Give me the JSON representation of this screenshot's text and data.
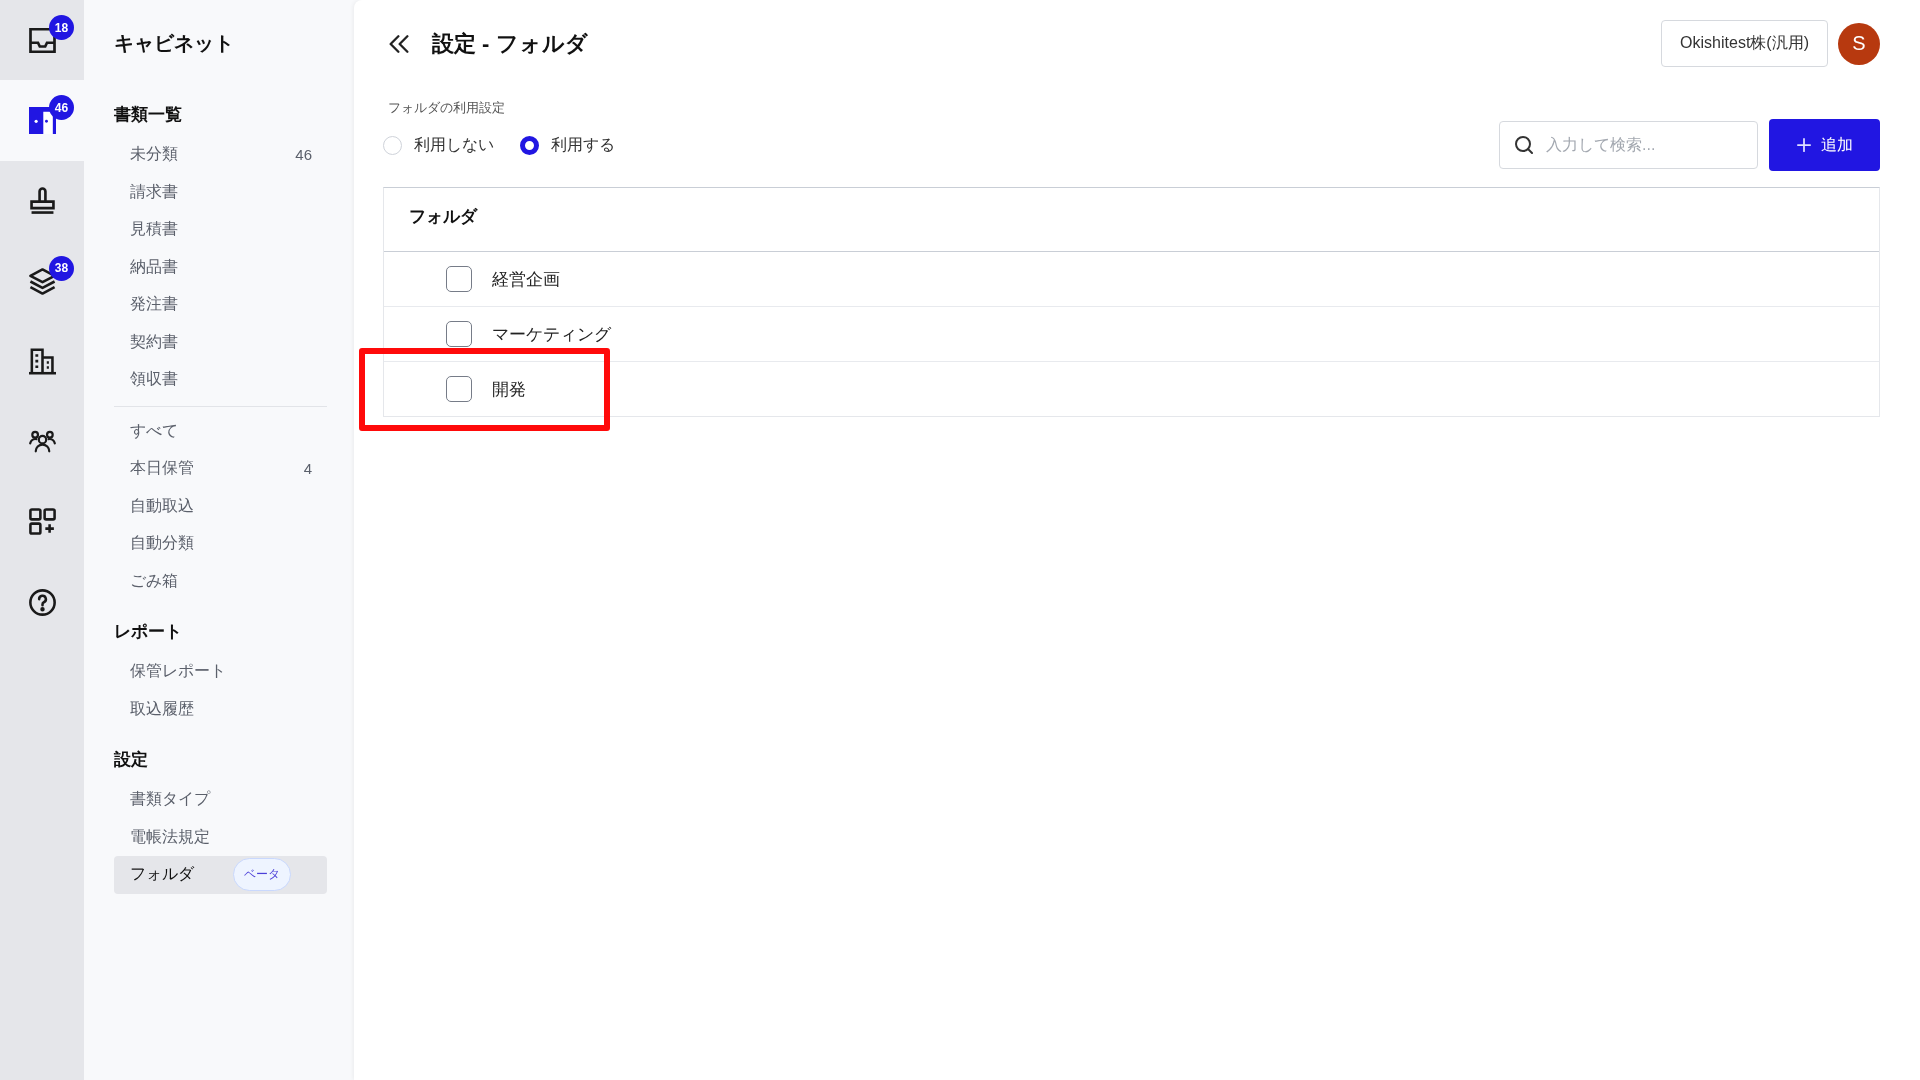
{
  "rail": [
    {
      "kind": "inbox",
      "badge": "18",
      "selected": false
    },
    {
      "kind": "cabinet",
      "badge": "46",
      "selected": true
    },
    {
      "kind": "stamp",
      "selected": false
    },
    {
      "kind": "layers",
      "badge": "38",
      "selected": false
    },
    {
      "kind": "building",
      "selected": false
    },
    {
      "kind": "people",
      "selected": false
    },
    {
      "kind": "apps",
      "selected": false
    },
    {
      "kind": "help",
      "selected": false
    }
  ],
  "sidebar": {
    "title": "キャビネット",
    "sections": [
      {
        "heading": "書類一覧",
        "groups": [
          [
            {
              "label": "未分類",
              "count": "46",
              "selected": false
            },
            {
              "label": "請求書",
              "selected": false
            },
            {
              "label": "見積書",
              "selected": false
            },
            {
              "label": "納品書",
              "selected": false
            },
            {
              "label": "発注書",
              "selected": false
            },
            {
              "label": "契約書",
              "selected": false
            },
            {
              "label": "領収書",
              "selected": false
            }
          ],
          [
            {
              "label": "すべて",
              "selected": false
            },
            {
              "label": "本日保管",
              "count": "4",
              "selected": false
            },
            {
              "label": "自動取込",
              "selected": false
            },
            {
              "label": "自動分類",
              "selected": false
            },
            {
              "label": "ごみ箱",
              "selected": false
            }
          ]
        ]
      },
      {
        "heading": "レポート",
        "groups": [
          [
            {
              "label": "保管レポート",
              "selected": false
            },
            {
              "label": "取込履歴",
              "selected": false
            }
          ]
        ]
      },
      {
        "heading": "設定",
        "groups": [
          [
            {
              "label": "書類タイプ",
              "selected": false
            },
            {
              "label": "電帳法規定",
              "selected": false
            },
            {
              "label": "フォルダ",
              "badge": "ベータ",
              "selected": true
            }
          ]
        ]
      }
    ]
  },
  "header": {
    "title": "設定 - フォルダ",
    "account": "Okishitest株(汎用)",
    "avatar": "S"
  },
  "usage": {
    "label": "フォルダの利用設定",
    "options": [
      {
        "label": "利用しない",
        "selected": false
      },
      {
        "label": "利用する",
        "selected": true
      }
    ]
  },
  "search": {
    "placeholder": "入力して検索..."
  },
  "add_button": {
    "label": "追加"
  },
  "table": {
    "columns": [
      "フォルダ"
    ],
    "rows": [
      {
        "name": "経営企画",
        "checked": false,
        "highlighted": false
      },
      {
        "name": "マーケティング",
        "checked": false,
        "highlighted": false
      },
      {
        "name": "開発",
        "checked": false,
        "highlighted": true
      }
    ]
  }
}
